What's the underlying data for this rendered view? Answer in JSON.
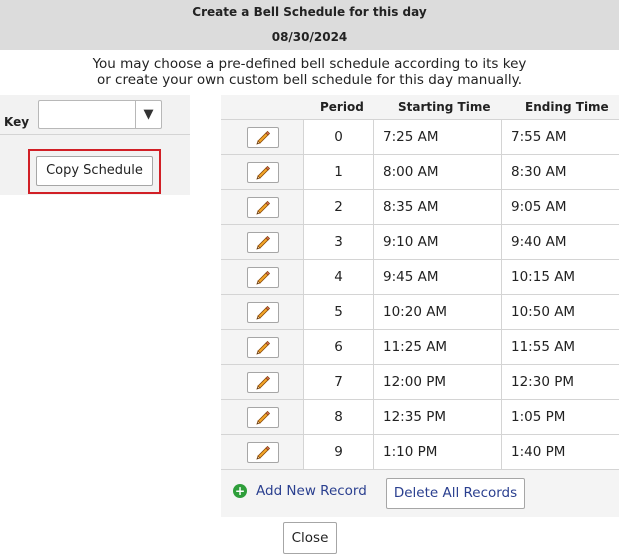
{
  "header": {
    "title": "Create a Bell Schedule for this day",
    "date": "08/30/2024"
  },
  "intro": {
    "line1": "You may choose a pre-defined bell schedule according to its key",
    "line2": "or create your own custom bell schedule for this day manually."
  },
  "key_selector": {
    "label": "Key",
    "value": "",
    "arrow_glyph": "▼"
  },
  "copy_button_label": "Copy Schedule",
  "table": {
    "columns": [
      "Period",
      "Starting Time",
      "Ending Time"
    ],
    "rows": [
      {
        "period": "0",
        "start": "7:25 AM",
        "end": "7:55 AM"
      },
      {
        "period": "1",
        "start": "8:00 AM",
        "end": "8:30 AM"
      },
      {
        "period": "2",
        "start": "8:35 AM",
        "end": "9:05 AM"
      },
      {
        "period": "3",
        "start": "9:10 AM",
        "end": "9:40 AM"
      },
      {
        "period": "4",
        "start": "9:45 AM",
        "end": "10:15 AM"
      },
      {
        "period": "5",
        "start": "10:20 AM",
        "end": "10:50 AM"
      },
      {
        "period": "6",
        "start": "11:25 AM",
        "end": "11:55 AM"
      },
      {
        "period": "7",
        "start": "12:00 PM",
        "end": "12:30 PM"
      },
      {
        "period": "8",
        "start": "12:35 PM",
        "end": "1:05 PM"
      },
      {
        "period": "9",
        "start": "1:10 PM",
        "end": "1:40 PM"
      }
    ]
  },
  "actions": {
    "add_label": "Add New Record",
    "delete_label": "Delete All Records"
  },
  "close_label": "Close",
  "icons": {
    "edit": "pencil-icon",
    "add": "plus-circle-icon",
    "dropdown": "chevron-down-icon"
  },
  "colors": {
    "title_bar": "#dcdcdc",
    "highlight_border": "#d11f26",
    "link_text": "#2a3f8f",
    "add_icon": "#2e9e3a",
    "pencil_body": "#f3a526"
  }
}
